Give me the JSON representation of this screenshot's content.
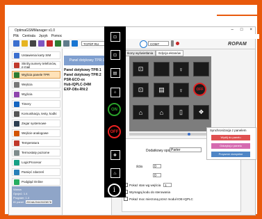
{
  "outer": {
    "minimize": "—",
    "maximize": "☐",
    "close": "✕"
  },
  "window": {
    "title": "OptimaGSMManager v1.0",
    "minimize": "–",
    "maximize": "□",
    "close": "×"
  },
  "menu": [
    "Plik",
    "Centrala",
    "Język",
    "Pomoc"
  ],
  "toolbar": {
    "combo1": "TCP/IP RU",
    "combo2": "COM7",
    "brand": "ROPAM"
  },
  "sidebar": {
    "items": [
      {
        "label": "Ustawienia karty SIM",
        "icon": "sim-icon",
        "color": "#3b6fcf"
      },
      {
        "label": "Skróty,numery telefonów, e-mail",
        "icon": "contacts-icon",
        "color": "#c0392b"
      },
      {
        "label": "Wyjścia panele TPR",
        "icon": "panel-icon",
        "color": "#2e7d32"
      },
      {
        "label": "Wejścia",
        "icon": "input-icon",
        "color": "#777777"
      },
      {
        "label": "Wyjścia",
        "icon": "output-icon",
        "color": "#8e44ad"
      },
      {
        "label": "Timery",
        "icon": "timer-icon",
        "color": "#1565c0"
      },
      {
        "label": "Komunikacja, testy, kodki",
        "icon": "comm-icon",
        "color": "#555555"
      },
      {
        "label": "Zegar systemowe",
        "icon": "clock-icon",
        "color": "#2c3e50"
      },
      {
        "label": "Wejście analogowe",
        "icon": "analog-icon",
        "color": "#d35400"
      },
      {
        "label": "Temperatura",
        "icon": "thermo-icon",
        "color": "#c0392b"
      },
      {
        "label": "Termostaty poziome",
        "icon": "thermostat-icon",
        "color": "#7f8c8d"
      },
      {
        "label": "LogicProcesor",
        "icon": "logic-icon",
        "color": "#16a085"
      },
      {
        "label": "Pamięć zdarzeń",
        "icon": "memory-icon",
        "color": "#2980b9"
      },
      {
        "label": "Podgląd Online",
        "icon": "online-icon",
        "color": "#27ae60"
      }
    ],
    "active_index": 2,
    "status": {
      "title": "Warsw",
      "line1": "Opcja1: 1.4",
      "line2": "Program: 1.4",
      "id_label": "ID panel",
      "id_value": "2004A20443023878"
    }
  },
  "panel_list": {
    "header": "Panel dotykowy TPR:1",
    "items": [
      "Panel dotykowy TPR:1",
      "Panel dotykowy TPR:2",
      "PSR-ECO-xx",
      "Hub-IQPLC-D4M",
      "EXP-O8x-RN:2"
    ]
  },
  "tabs": [
    "Ikony wyświetlania",
    "Edycja ekranów"
  ],
  "props": {
    "desc_label": "Dodatkowy opis:",
    "desc_value": "Parter",
    "stepper1_label": "ścia",
    "stepper1_value": "0",
    "stepper2_value": "0",
    "check1": "Pokaż stan wg wejścia",
    "check1_value": "1",
    "check2": "Wymagaj kodu do sterowania",
    "check3": "Pokaż moc mierzoną przez moduł IOE-IQPLC"
  },
  "sync": {
    "title": "Synchronizacja z panelem",
    "btn1": "Wyślij do panelu",
    "btn1_color": "#e05050",
    "btn2": "Odczytaj z panelu",
    "btn2_color": "#d56bb0",
    "btn3": "Przywróć domyślne",
    "btn3_color": "#4f86c6"
  },
  "toolstrip": {
    "items": [
      {
        "label": "",
        "icon": "door-icon"
      },
      {
        "label": "",
        "icon": "tile-icon"
      },
      {
        "label": "",
        "icon": "gate-icon"
      },
      {
        "label": "",
        "icon": "home-icon"
      },
      {
        "label": "ON",
        "icon": "on-icon"
      },
      {
        "label": "OFF",
        "icon": "off-icon"
      },
      {
        "label": "",
        "icon": "drops-icon"
      },
      {
        "label": "",
        "icon": "thermo-drop-icon"
      },
      {
        "label": "i",
        "icon": "info-icon"
      }
    ]
  },
  "grid": {
    "cells": [
      {
        "icon": "door-icon",
        "label": "⊡",
        "variant": "plain"
      },
      {
        "icon": "blank-icon",
        "label": "",
        "variant": "plain"
      },
      {
        "icon": "bulb-icon",
        "label": "♀",
        "variant": "plain"
      },
      {
        "icon": "blank-icon",
        "label": "",
        "variant": "plain"
      },
      {
        "icon": "tile-icon",
        "label": "⊡",
        "variant": "plain"
      },
      {
        "icon": "shutter-icon",
        "label": "▤",
        "variant": "plain"
      },
      {
        "icon": "bulb-icon",
        "label": "♀",
        "variant": "plain"
      },
      {
        "icon": "off-icon",
        "label": "OFF",
        "variant": "red"
      },
      {
        "icon": "home-icon",
        "label": "⌂",
        "variant": "plain"
      },
      {
        "icon": "home-icon",
        "label": "⌂",
        "variant": "plain"
      },
      {
        "icon": "phone-icon",
        "label": "▯",
        "variant": "plain"
      },
      {
        "icon": "drops-icon",
        "label": "❖",
        "variant": "plain"
      }
    ]
  }
}
